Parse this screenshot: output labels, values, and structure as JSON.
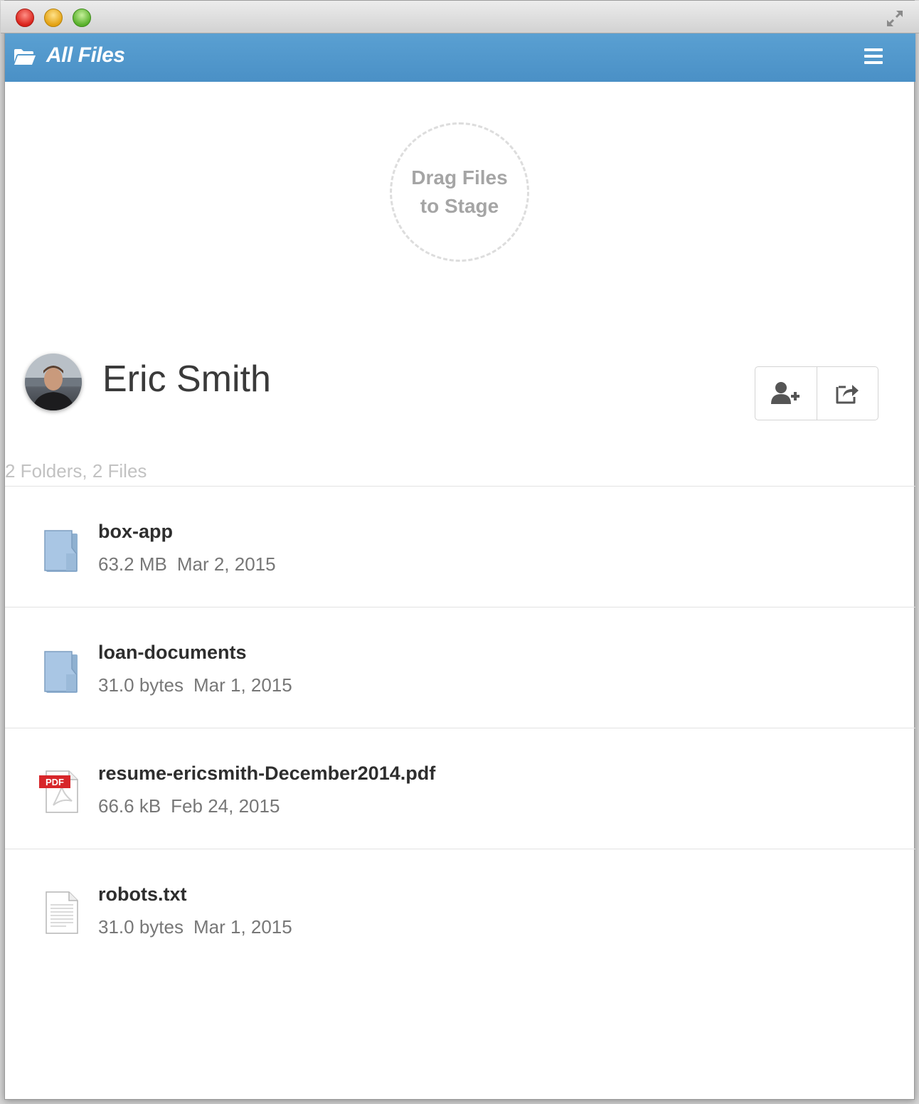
{
  "window": {
    "controls": [
      "close",
      "minimize",
      "zoom"
    ],
    "fullscreen_icon": "fullscreen-arrows-icon"
  },
  "header": {
    "title": "All Files",
    "folder_icon": "folder-open-icon",
    "menu_icon": "hamburger-menu-icon",
    "color": "#4f96cb"
  },
  "dropzone": {
    "line1": "Drag Files",
    "line2": "to Stage"
  },
  "profile": {
    "name": "Eric Smith",
    "actions": [
      {
        "icon": "add-user-icon"
      },
      {
        "icon": "share-icon"
      }
    ]
  },
  "summary": "2 Folders, 2 Files",
  "files": [
    {
      "name": "box-app",
      "size": "63.2 MB",
      "date": "Mar 2, 2015",
      "type": "folder"
    },
    {
      "name": "loan-documents",
      "size": "31.0 bytes",
      "date": "Mar 1, 2015",
      "type": "folder"
    },
    {
      "name": "resume-ericsmith-December2014.pdf",
      "size": "66.6 kB",
      "date": "Feb 24, 2015",
      "type": "pdf",
      "badge": "PDF"
    },
    {
      "name": "robots.txt",
      "size": "31.0 bytes",
      "date": "Mar 1, 2015",
      "type": "text"
    }
  ]
}
